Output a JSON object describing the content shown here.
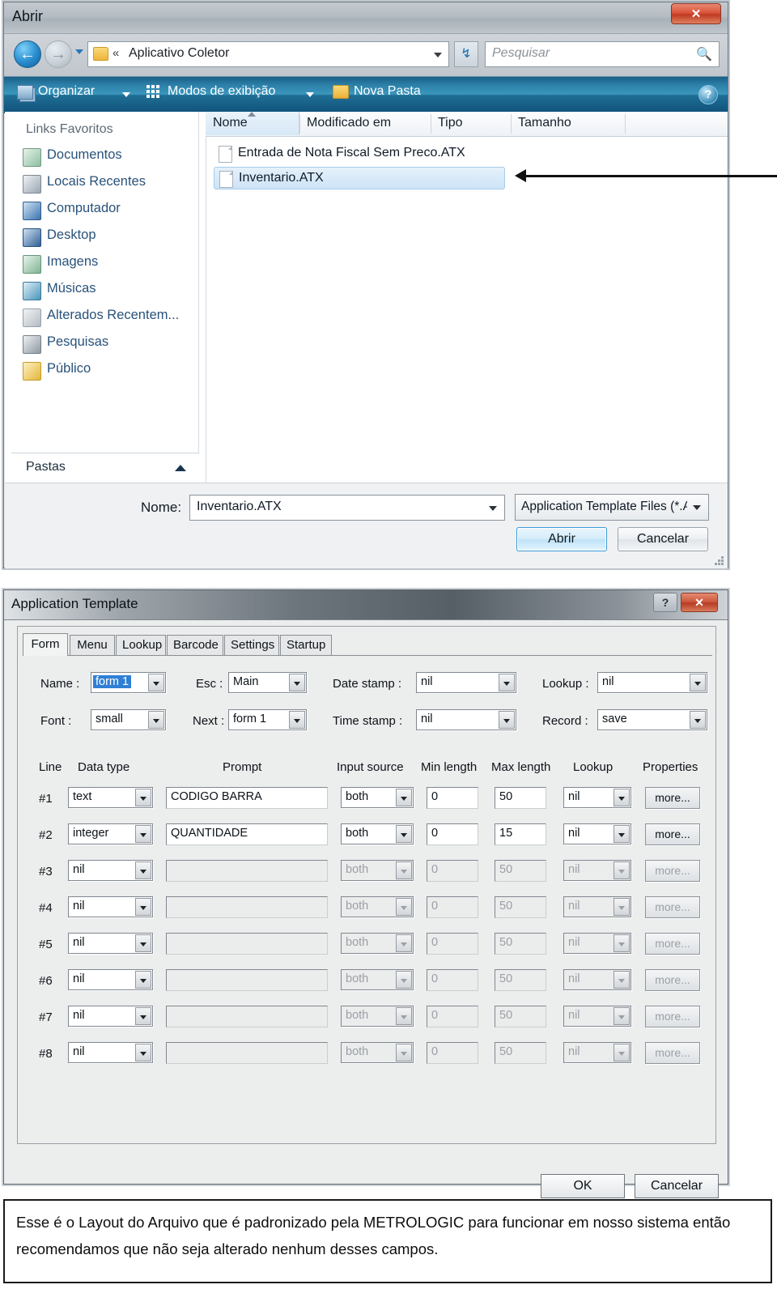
{
  "open_dialog": {
    "title": "Abrir",
    "close_label": "✕",
    "nav": {
      "back_icon": "back-arrow-icon",
      "forward_icon": "forward-arrow-icon",
      "history_dropdown_icon": "chevron-down-icon",
      "address_chevron": "«",
      "address_value": "Aplicativo Coletor",
      "refresh_icon": "↯",
      "search_placeholder": "Pesquisar",
      "search_icon": "search-icon"
    },
    "toolbar": {
      "organize_label": "Organizar",
      "views_label": "Modos de exibição",
      "new_folder_label": "Nova Pasta",
      "help_label": "?"
    },
    "sidebar": {
      "header": "Links Favoritos",
      "items": [
        {
          "label": "Documentos",
          "icon": "documents-icon",
          "color1": "#dfeee4",
          "color2": "#8fbfa0"
        },
        {
          "label": "Locais Recentes",
          "icon": "recent-places-icon",
          "color1": "#e3e7ea",
          "color2": "#9aa6b2"
        },
        {
          "label": "Computador",
          "icon": "computer-icon",
          "color1": "#cfe3f5",
          "color2": "#3b73ad"
        },
        {
          "label": "Desktop",
          "icon": "desktop-icon",
          "color1": "#cfe0f2",
          "color2": "#2f5f94"
        },
        {
          "label": "Imagens",
          "icon": "pictures-icon",
          "color1": "#dff0e6",
          "color2": "#7fb392"
        },
        {
          "label": "Músicas",
          "icon": "music-icon",
          "color1": "#d8ecf6",
          "color2": "#4a94b8"
        },
        {
          "label": "Alterados Recentem...",
          "icon": "recently-changed-icon",
          "color1": "#eceef0",
          "color2": "#b2bac2"
        },
        {
          "label": "Pesquisas",
          "icon": "searches-icon",
          "color1": "#e6e9ec",
          "color2": "#8e98a2"
        },
        {
          "label": "Público",
          "icon": "public-folder-icon",
          "color1": "#fbe9a8",
          "color2": "#e3b63a"
        }
      ],
      "footer_label": "Pastas",
      "footer_chevron_icon": "chevron-up-icon"
    },
    "file_list": {
      "columns": [
        "Nome",
        "Modificado em",
        "Tipo",
        "Tamanho"
      ],
      "sort_column": "Nome",
      "sort_direction": "ascending",
      "rows": [
        {
          "name": "Entrada de Nota Fiscal Sem Preco.ATX",
          "selected": false
        },
        {
          "name": "Inventario.ATX",
          "selected": true
        }
      ]
    },
    "bottom": {
      "name_label": "Nome:",
      "name_value": "Inventario.ATX",
      "filter_value": "Application Template Files (*.A",
      "open_button": "Abrir",
      "cancel_button": "Cancelar"
    }
  },
  "annotation": {
    "arrow_icon": "left-pointing-arrow",
    "target": "Inventario.ATX"
  },
  "app_template": {
    "title": "Application Template",
    "help_label": "?",
    "close_label": "✕",
    "tabs": [
      {
        "label": "Form",
        "active": true
      },
      {
        "label": "Menu",
        "active": false
      },
      {
        "label": "Lookup",
        "active": false
      },
      {
        "label": "Barcode",
        "active": false
      },
      {
        "label": "Settings",
        "active": false
      },
      {
        "label": "Startup",
        "active": false
      }
    ],
    "form_fields": [
      {
        "label": "Name :",
        "value": "form 1",
        "highlighted": true
      },
      {
        "label": "Font :",
        "value": "small",
        "highlighted": false
      },
      {
        "label": "Esc :",
        "value": "Main",
        "highlighted": false
      },
      {
        "label": "Next :",
        "value": "form 1",
        "highlighted": false
      },
      {
        "label": "Date stamp :",
        "value": "nil",
        "highlighted": false
      },
      {
        "label": "Time stamp :",
        "value": "nil",
        "highlighted": false
      },
      {
        "label": "Lookup :",
        "value": "nil",
        "highlighted": false
      },
      {
        "label": "Record :",
        "value": "save",
        "highlighted": false
      }
    ],
    "table": {
      "headers": [
        "Line",
        "Data type",
        "Prompt",
        "Input source",
        "Min length",
        "Max length",
        "Lookup",
        "Properties"
      ],
      "more_label": "more...",
      "rows": [
        {
          "line": "#1",
          "data_type": "text",
          "prompt": "CODIGO BARRA",
          "input_source": "both",
          "min_length": "0",
          "max_length": "50",
          "lookup": "nil",
          "enabled": true
        },
        {
          "line": "#2",
          "data_type": "integer",
          "prompt": "QUANTIDADE",
          "input_source": "both",
          "min_length": "0",
          "max_length": "15",
          "lookup": "nil",
          "enabled": true
        },
        {
          "line": "#3",
          "data_type": "nil",
          "prompt": "",
          "input_source": "both",
          "min_length": "0",
          "max_length": "50",
          "lookup": "nil",
          "enabled": false
        },
        {
          "line": "#4",
          "data_type": "nil",
          "prompt": "",
          "input_source": "both",
          "min_length": "0",
          "max_length": "50",
          "lookup": "nil",
          "enabled": false
        },
        {
          "line": "#5",
          "data_type": "nil",
          "prompt": "",
          "input_source": "both",
          "min_length": "0",
          "max_length": "50",
          "lookup": "nil",
          "enabled": false
        },
        {
          "line": "#6",
          "data_type": "nil",
          "prompt": "",
          "input_source": "both",
          "min_length": "0",
          "max_length": "50",
          "lookup": "nil",
          "enabled": false
        },
        {
          "line": "#7",
          "data_type": "nil",
          "prompt": "",
          "input_source": "both",
          "min_length": "0",
          "max_length": "50",
          "lookup": "nil",
          "enabled": false
        },
        {
          "line": "#8",
          "data_type": "nil",
          "prompt": "",
          "input_source": "both",
          "min_length": "0",
          "max_length": "50",
          "lookup": "nil",
          "enabled": false
        }
      ]
    },
    "ok_button": "OK",
    "cancel_button": "Cancelar"
  },
  "caption": {
    "text": "Esse é o Layout do Arquivo que é padronizado pela METROLOGIC para funcionar em nosso sistema então recomendamos que não seja alterado nenhum desses campos."
  },
  "colors": {
    "toolbar_blue": "#2c7fa8",
    "sidebar_link": "#29527a",
    "selection_blue": "#2f7fd6",
    "close_red": "#cd5a3e",
    "accent_open_button": "#3c9ad6"
  }
}
